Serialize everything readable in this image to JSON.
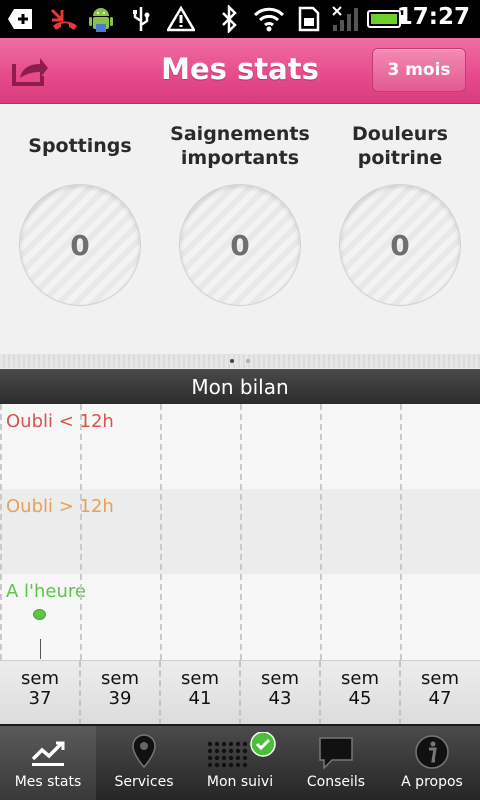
{
  "status_bar": {
    "time": "17:27",
    "icons": [
      "notification-plus-icon",
      "missed-call-icon",
      "android-debug-icon",
      "usb-icon",
      "warning-icon",
      "bluetooth-icon",
      "wifi-icon",
      "sim-card-icon",
      "signal-icon",
      "battery-icon"
    ]
  },
  "header": {
    "title": "Mes stats",
    "period_button": "3 mois",
    "share_icon": "share-icon"
  },
  "stats": [
    {
      "label": "Spottings",
      "value": "0"
    },
    {
      "label": "Saignements importants",
      "value": "0"
    },
    {
      "label": "Douleurs poitrine",
      "value": "0"
    }
  ],
  "pager": {
    "pages": 2,
    "active": 0
  },
  "bilan": {
    "title": "Mon bilan",
    "rows": [
      {
        "label": "Oubli < 12h",
        "color": "#d9534f"
      },
      {
        "label": "Oubli > 12h",
        "color": "#e8a058"
      },
      {
        "label": "A l'heure",
        "color": "#5cc64c"
      }
    ],
    "weeks": [
      {
        "prefix": "sem",
        "number": "37"
      },
      {
        "prefix": "sem",
        "number": "39"
      },
      {
        "prefix": "sem",
        "number": "41"
      },
      {
        "prefix": "sem",
        "number": "43"
      },
      {
        "prefix": "sem",
        "number": "45"
      },
      {
        "prefix": "sem",
        "number": "47"
      }
    ],
    "markers": [
      {
        "row": "A l'heure",
        "week": "37"
      }
    ]
  },
  "tabs": [
    {
      "label": "Mes stats",
      "icon": "chart-icon",
      "active": true
    },
    {
      "label": "Services",
      "icon": "map-pin-icon",
      "active": false
    },
    {
      "label": "Mon suivi",
      "icon": "pill-grid-icon",
      "active": false
    },
    {
      "label": "Conseils",
      "icon": "speech-bubble-icon",
      "active": false
    },
    {
      "label": "A propos",
      "icon": "info-icon",
      "active": false
    }
  ],
  "colors": {
    "header_pink": "#e74c8c",
    "accent_green": "#5cc64c"
  }
}
